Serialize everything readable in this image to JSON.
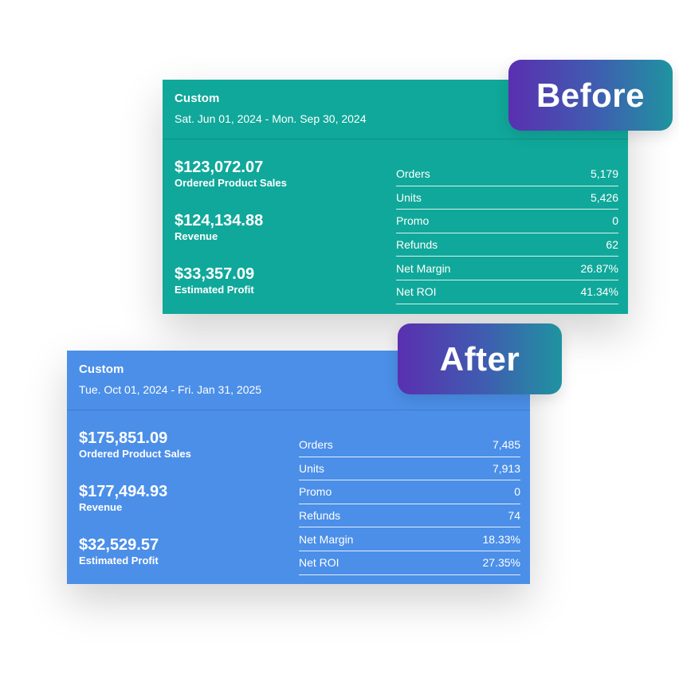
{
  "before": {
    "badge": "Before",
    "title": "Custom",
    "date_range": "Sat. Jun 01, 2024 - Mon. Sep 30, 2024",
    "metrics": [
      {
        "value": "$123,072.07",
        "label": "Ordered Product Sales"
      },
      {
        "value": "$124,134.88",
        "label": "Revenue"
      },
      {
        "value": "$33,357.09",
        "label": "Estimated Profit"
      }
    ],
    "stats": [
      {
        "label": "Orders",
        "value": "5,179"
      },
      {
        "label": "Units",
        "value": "5,426"
      },
      {
        "label": "Promo",
        "value": "0"
      },
      {
        "label": "Refunds",
        "value": "62"
      },
      {
        "label": "Net Margin",
        "value": "26.87%"
      },
      {
        "label": "Net ROI",
        "value": "41.34%"
      }
    ],
    "color": "#10a89a"
  },
  "after": {
    "badge": "After",
    "title": "Custom",
    "date_range": "Tue. Oct 01, 2024 - Fri. Jan 31, 2025",
    "metrics": [
      {
        "value": "$175,851.09",
        "label": "Ordered Product Sales"
      },
      {
        "value": "$177,494.93",
        "label": "Revenue"
      },
      {
        "value": "$32,529.57",
        "label": "Estimated Profit"
      }
    ],
    "stats": [
      {
        "label": "Orders",
        "value": "7,485"
      },
      {
        "label": "Units",
        "value": "7,913"
      },
      {
        "label": "Promo",
        "value": "0"
      },
      {
        "label": "Refunds",
        "value": "74"
      },
      {
        "label": "Net Margin",
        "value": "18.33%"
      },
      {
        "label": "Net ROI",
        "value": "27.35%"
      }
    ],
    "color": "#4b8fe8"
  }
}
